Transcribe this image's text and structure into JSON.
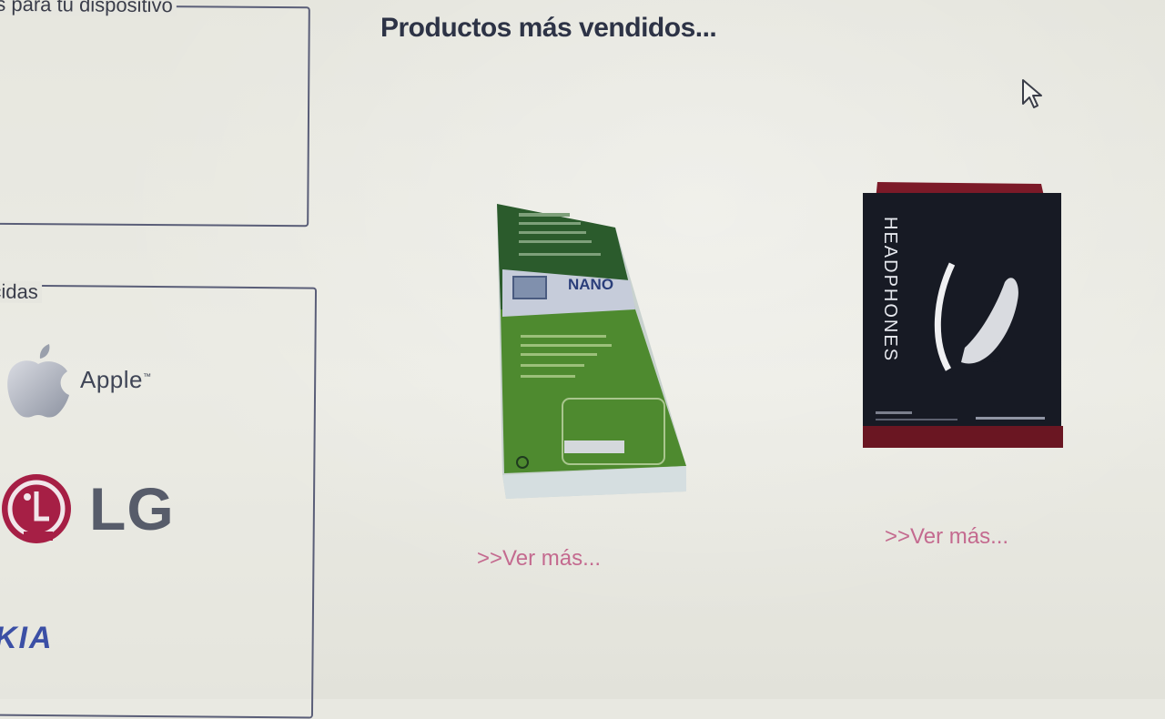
{
  "sidebar": {
    "accessories_title": "rios para tu dispositivo",
    "brands_title": "nocidas",
    "brands": [
      {
        "label": "Apple",
        "icon": "apple-logo-icon"
      },
      {
        "label": "LG",
        "icon": "lg-logo-icon"
      },
      {
        "label": "KIA",
        "icon": "nokia-logo-icon"
      }
    ]
  },
  "main": {
    "section_title": "Productos más vendidos...",
    "products": [
      {
        "image_icon": "nano-sim-adapter-package-icon",
        "package_text": "NANO",
        "more_link": ">>Ver más..."
      },
      {
        "image_icon": "headphones-package-icon",
        "package_text": "HEADPHONES",
        "more_link": ">>Ver más..."
      }
    ]
  },
  "colors": {
    "panel_border": "#5a5e78",
    "link": "#c46a8f",
    "title": "#2d3346",
    "nokia_blue": "#3b4fa5",
    "lg_red": "#a61f45"
  }
}
